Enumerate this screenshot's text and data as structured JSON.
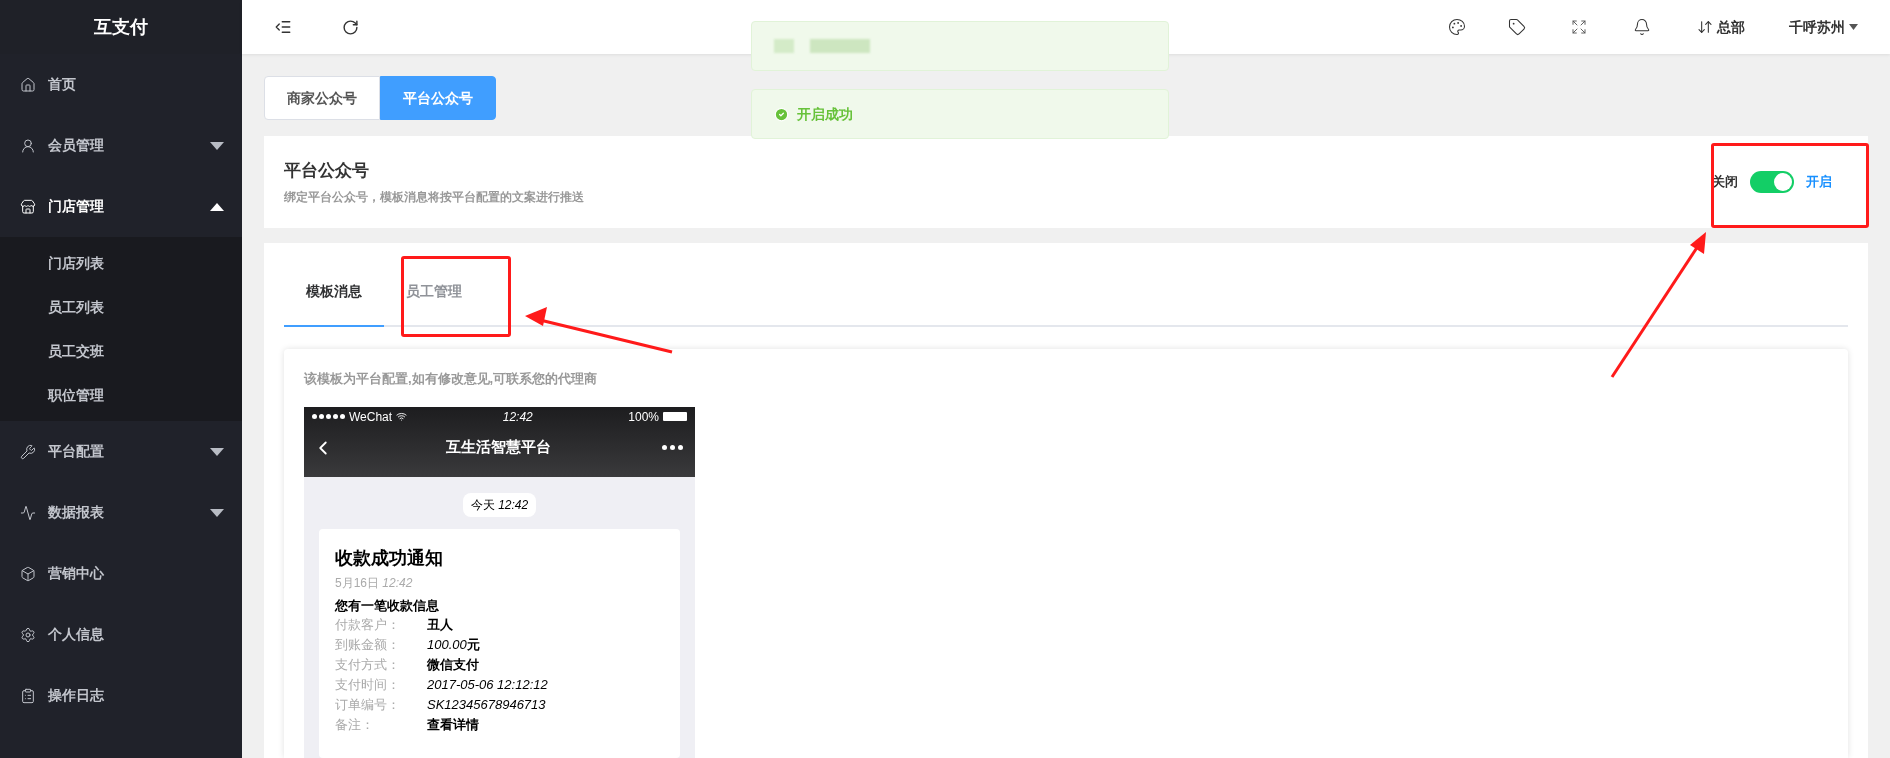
{
  "sidebar": {
    "logo": "互支付",
    "items": [
      {
        "label": "首页",
        "kind": "link"
      },
      {
        "label": "会员管理",
        "kind": "group",
        "expanded": false
      },
      {
        "label": "门店管理",
        "kind": "group",
        "expanded": true,
        "children": [
          {
            "label": "门店列表"
          },
          {
            "label": "员工列表"
          },
          {
            "label": "员工交班"
          },
          {
            "label": "职位管理"
          }
        ]
      },
      {
        "label": "平台配置",
        "kind": "group",
        "expanded": false
      },
      {
        "label": "数据报表",
        "kind": "group",
        "expanded": false
      },
      {
        "label": "营销中心",
        "kind": "link"
      },
      {
        "label": "个人信息",
        "kind": "link"
      },
      {
        "label": "操作日志",
        "kind": "link"
      }
    ]
  },
  "topbar": {
    "branch": "总部",
    "user": "千呼苏州"
  },
  "toasts": [
    {
      "kind": "blurred"
    },
    {
      "kind": "success",
      "text": "开启成功"
    }
  ],
  "account_tabs": [
    {
      "label": "商家公众号",
      "selected": false
    },
    {
      "label": "平台公众号",
      "selected": true
    }
  ],
  "header": {
    "title": "平台公众号",
    "subtitle": "绑定平台公众号，模板消息将按平台配置的文案进行推送",
    "toggle": {
      "off_label": "关闭",
      "on_label": "开启",
      "on": true
    }
  },
  "content_tabs": [
    {
      "label": "模板消息",
      "selected": true
    },
    {
      "label": "员工管理",
      "selected": false
    }
  ],
  "template": {
    "hint": "该模板为平台配置,如有修改意见,可联系您的代理商",
    "phone": {
      "carrier": "WeChat",
      "clock": "12:42",
      "battery": "100%",
      "chat_title": "互生活智慧平台",
      "time_chip": "今天 *12:42*",
      "card": {
        "title": "收款成功通知",
        "date": "5月16日 *12:42*",
        "intro": "您有一笔收款信息",
        "rows": [
          {
            "label": "付款客户：",
            "kind": "plain",
            "value": "丑人"
          },
          {
            "label": "到账金额：",
            "kind": "amount",
            "value": "100.00",
            "unit": "元"
          },
          {
            "label": "支付方式：",
            "kind": "plain",
            "value": "微信支付"
          },
          {
            "label": "支付时间：",
            "kind": "italic",
            "value": "2017-05-06 12:12:12"
          },
          {
            "label": "订单编号：",
            "kind": "italic",
            "value": "SK12345678946713"
          },
          {
            "label": "备注：",
            "kind": "plain",
            "value": "查看详情"
          }
        ]
      }
    }
  }
}
